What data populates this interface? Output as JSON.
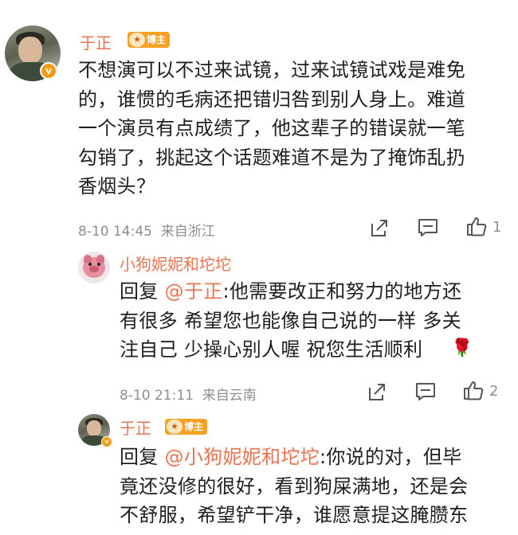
{
  "comments": [
    {
      "author": "于正",
      "badge": "博主",
      "verified_mark": "v",
      "text": "不想演可以不过来试镜，过来试镜试戏是难免的，谁惯的毛病还把错归咎到别人身上。难道一个演员有点成绩了，他这辈子的错误就一笔勾销了，挑起这个话题难道不是为了掩饰乱扔香烟头？",
      "lines": [
        "不想演可以不过来试镜，过来试镜试戏是难免",
        "的，谁惯的毛病还把错归咎到别人身上。难道",
        "一个演员有点成绩了，他这辈子的错误就一笔",
        "勾销了，挑起这个话题难道不是为了掩饰乱扔",
        "香烟头？"
      ],
      "time": "8-10 14:45",
      "location": "来自浙江",
      "like_count": "1"
    },
    {
      "author": "小狗妮妮和坨坨",
      "reply_prefix": "回复",
      "mention": "@于正",
      "lines": [
        ":他需要改正和努力的地方还",
        "有很多 希望您也能像自己说的一样 多关",
        "注自己 少操心别人喔 祝您生活顺利"
      ],
      "emoji": "rose-icon",
      "time": "8-10 21:11",
      "location": "来自云南",
      "like_count": "2"
    },
    {
      "author": "于正",
      "badge": "博主",
      "verified_mark": "v",
      "reply_prefix": "回复",
      "mention": "@小狗妮妮和坨坨",
      "lines": [
        ":你说的对，但毕",
        "竟还没修的很好，看到狗屎满地，还是会",
        "不舒服，希望铲干净，谁愿意提这腌臜东"
      ]
    }
  ],
  "icons": {
    "share": "share-icon",
    "comment": "comment-icon",
    "like": "thumbs-up-icon"
  },
  "colors": {
    "name": "#eb7350",
    "badge": "#f7a021",
    "meta": "#8e8e8e"
  }
}
